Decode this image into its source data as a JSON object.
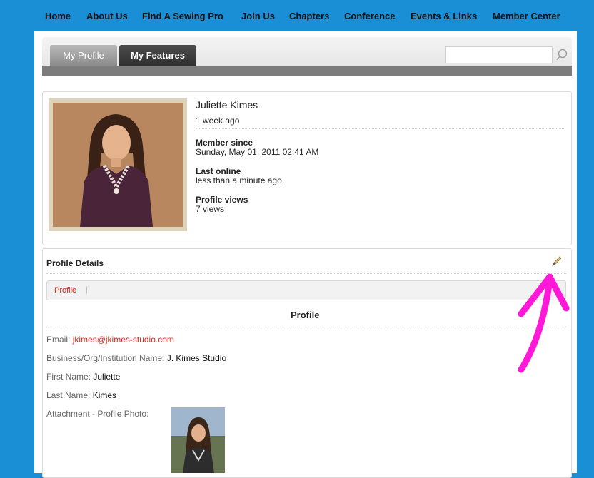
{
  "nav": {
    "items": [
      "Home",
      "About Us",
      "Find A Sewing Pro",
      "Join Us",
      "Chapters",
      "Conference",
      "Events & Links",
      "Member Center"
    ]
  },
  "tabs": {
    "my_profile": "My Profile",
    "my_features": "My Features"
  },
  "search": {
    "value": "",
    "icon": "search-icon"
  },
  "profile": {
    "name": "Juliette Kimes",
    "last_update": "1 week ago",
    "member_since_label": "Member since",
    "member_since_value": "Sunday, May 01, 2011 02:41 AM",
    "last_online_label": "Last online",
    "last_online_value": "less than a minute ago",
    "profile_views_label": "Profile views",
    "profile_views_value": "7 views"
  },
  "details": {
    "heading": "Profile Details",
    "edit_icon": "pencil-icon",
    "tab_label": "Profile",
    "section_title": "Profile",
    "email_label": "Email:",
    "email_value": "jkimes@jkimes-studio.com",
    "business_label": "Business/Org/Institution Name:",
    "business_value": "J. Kimes Studio",
    "first_name_label": "First Name:",
    "first_name_value": "Juliette",
    "last_name_label": "Last Name:",
    "last_name_value": "Kimes",
    "attachment_label": "Attachment - Profile Photo:"
  },
  "colors": {
    "page_bg": "#1a8fd6",
    "link_red": "#d9281b",
    "annotation_arrow": "#ff18d8"
  }
}
